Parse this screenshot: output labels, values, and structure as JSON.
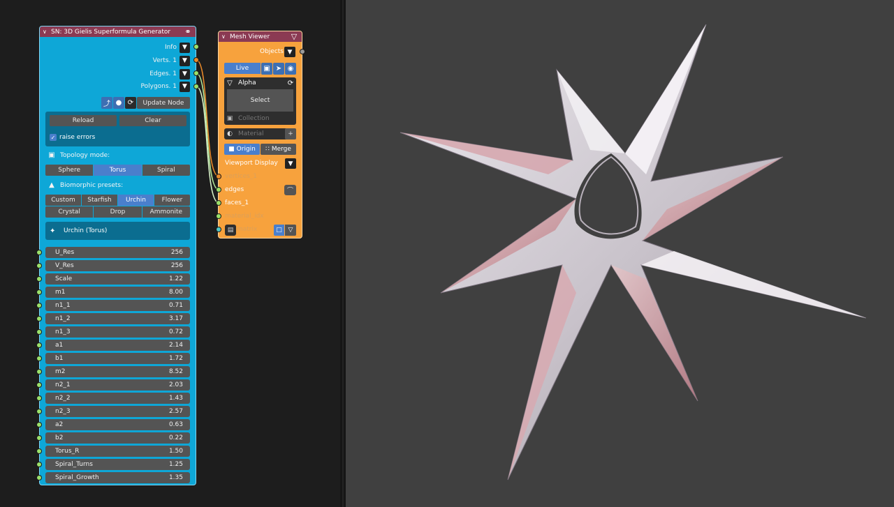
{
  "superformula_node": {
    "title": "SN: 3D Gielis Superformula Generator",
    "outputs": [
      {
        "label": "Info",
        "socket": "green"
      },
      {
        "label": "Verts. 1",
        "socket": "orange"
      },
      {
        "label": "Edges. 1",
        "socket": "green"
      },
      {
        "label": "Polygons. 1",
        "socket": "green"
      }
    ],
    "update_label": "Update Node",
    "reload_label": "Reload",
    "clear_label": "Clear",
    "raise_errors_label": "raise errors",
    "raise_errors_checked": true,
    "topology_label": "Topology mode:",
    "topology_options": [
      "Sphere",
      "Torus",
      "Spiral"
    ],
    "topology_selected": "Torus",
    "presets_label": "Biomorphic presets:",
    "presets_row1": [
      "Custom",
      "Starfish",
      "Urchin",
      "Flower"
    ],
    "presets_row2": [
      "Crystal",
      "Drop",
      "Ammonite"
    ],
    "preset_selected": "Urchin",
    "current_preset": "Urchin (Torus)",
    "params": [
      {
        "name": "U_Res",
        "value": "256"
      },
      {
        "name": "V_Res",
        "value": "256"
      },
      {
        "name": "Scale",
        "value": "1.22"
      },
      {
        "name": "m1",
        "value": "8.00"
      },
      {
        "name": "n1_1",
        "value": "0.71"
      },
      {
        "name": "n1_2",
        "value": "3.17"
      },
      {
        "name": "n1_3",
        "value": "0.72"
      },
      {
        "name": "a1",
        "value": "2.14"
      },
      {
        "name": "b1",
        "value": "1.72"
      },
      {
        "name": "m2",
        "value": "8.52"
      },
      {
        "name": "n2_1",
        "value": "2.03"
      },
      {
        "name": "n2_2",
        "value": "1.43"
      },
      {
        "name": "n2_3",
        "value": "2.57"
      },
      {
        "name": "a2",
        "value": "0.63"
      },
      {
        "name": "b2",
        "value": "0.22"
      },
      {
        "name": "Torus_R",
        "value": "1.50"
      },
      {
        "name": "Spiral_Turns",
        "value": "1.25"
      },
      {
        "name": "Spiral_Growth",
        "value": "1.35"
      }
    ]
  },
  "mesh_viewer": {
    "title": "Mesh Viewer",
    "objects_label": "Objects",
    "live_label": "Live",
    "object_name": "Alpha",
    "select_label": "Select",
    "collection_label": "Collection",
    "material_label": "Material",
    "origin_label": "Origin",
    "merge_label": "Merge",
    "viewport_display_label": "Viewport Display",
    "inputs": [
      "vertices_1",
      "edges",
      "faces_1",
      "material_idx",
      "matrix"
    ]
  },
  "colors": {
    "superformula_body": "#0ea7d7",
    "header": "#8b3a53",
    "mesh_viewer_body": "#f7a23d",
    "active_blue": "#4a7fcc",
    "viewport_bg": "#404040",
    "socket_green": "#9ae06a",
    "socket_orange": "#e98a2a"
  }
}
